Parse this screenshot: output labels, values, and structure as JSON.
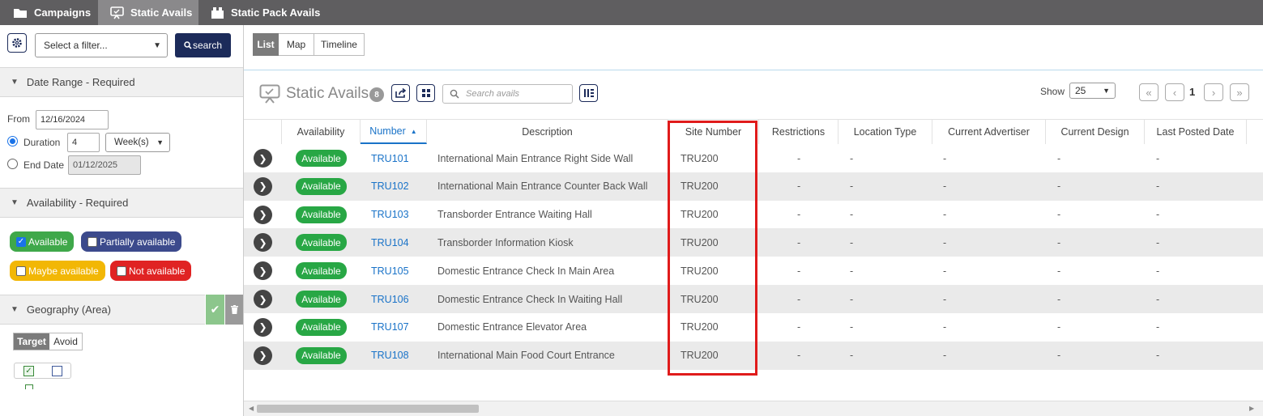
{
  "top_tabs": [
    {
      "label": "Campaigns",
      "icon": "folder-icon"
    },
    {
      "label": "Static Avails",
      "icon": "billboard-icon"
    },
    {
      "label": "Static Pack Avails",
      "icon": "pack-icon"
    }
  ],
  "filter": {
    "select_placeholder": "Select a filter...",
    "search_label": "search"
  },
  "date_range": {
    "title": "Date Range - Required",
    "from_label": "From",
    "from_value": "12/16/2024",
    "duration_label": "Duration",
    "duration_value": "4",
    "duration_unit": "Week(s)",
    "end_label": "End Date",
    "end_value": "01/12/2025"
  },
  "availability": {
    "title": "Availability - Required",
    "options": [
      {
        "label": "Available",
        "checked": true,
        "color": "#3fa84a"
      },
      {
        "label": "Partially available",
        "checked": false,
        "color": "#3c4a8c"
      },
      {
        "label": "Maybe available",
        "checked": false,
        "color": "#f2b705"
      },
      {
        "label": "Not available",
        "checked": false,
        "color": "#e02323"
      }
    ]
  },
  "geography": {
    "title": "Geography (Area)",
    "target_label": "Target",
    "avoid_label": "Avoid"
  },
  "views": {
    "list": "List",
    "map": "Map",
    "timeline": "Timeline"
  },
  "header": {
    "title": "Static Avails",
    "count": "8",
    "search_placeholder": "Search avails",
    "show_label": "Show",
    "page_size": "25",
    "page": "1"
  },
  "columns": [
    "Availability",
    "Number",
    "Description",
    "Site Number",
    "Restrictions",
    "Location Type",
    "Current Advertiser",
    "Current Design",
    "Last Posted Date"
  ],
  "rows": [
    {
      "status": "Available",
      "number": "TRU101",
      "description": "International Main Entrance Right Side Wall",
      "site": "TRU200",
      "restrictions": "-",
      "location_type": "-",
      "advertiser": "-",
      "design": "-",
      "last_posted": "-"
    },
    {
      "status": "Available",
      "number": "TRU102",
      "description": "International Main Entrance Counter Back Wall",
      "site": "TRU200",
      "restrictions": "-",
      "location_type": "-",
      "advertiser": "-",
      "design": "-",
      "last_posted": "-"
    },
    {
      "status": "Available",
      "number": "TRU103",
      "description": "Transborder Entrance Waiting Hall",
      "site": "TRU200",
      "restrictions": "-",
      "location_type": "-",
      "advertiser": "-",
      "design": "-",
      "last_posted": "-"
    },
    {
      "status": "Available",
      "number": "TRU104",
      "description": "Transborder Information Kiosk",
      "site": "TRU200",
      "restrictions": "-",
      "location_type": "-",
      "advertiser": "-",
      "design": "-",
      "last_posted": "-"
    },
    {
      "status": "Available",
      "number": "TRU105",
      "description": "Domestic Entrance Check In Main Area",
      "site": "TRU200",
      "restrictions": "-",
      "location_type": "-",
      "advertiser": "-",
      "design": "-",
      "last_posted": "-"
    },
    {
      "status": "Available",
      "number": "TRU106",
      "description": "Domestic Entrance Check In Waiting Hall",
      "site": "TRU200",
      "restrictions": "-",
      "location_type": "-",
      "advertiser": "-",
      "design": "-",
      "last_posted": "-"
    },
    {
      "status": "Available",
      "number": "TRU107",
      "description": "Domestic Entrance Elevator Area",
      "site": "TRU200",
      "restrictions": "-",
      "location_type": "-",
      "advertiser": "-",
      "design": "-",
      "last_posted": "-"
    },
    {
      "status": "Available",
      "number": "TRU108",
      "description": "International Main Food Court Entrance",
      "site": "TRU200",
      "restrictions": "-",
      "location_type": "-",
      "advertiser": "-",
      "design": "-",
      "last_posted": "-"
    }
  ],
  "colors": {
    "topbar": "#5f5e60",
    "active_tab": "#8a898b",
    "search_button": "#1c2b5a",
    "available_badge": "#28a745",
    "link": "#1a73c8",
    "highlight_box": "#e01b1b"
  }
}
